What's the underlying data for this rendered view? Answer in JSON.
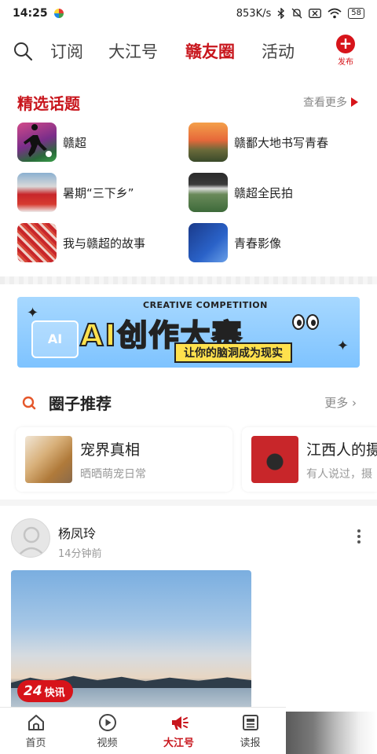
{
  "status_bar": {
    "time": "14:25",
    "network_speed": "853K/s",
    "battery": "58"
  },
  "top_nav": {
    "tabs": [
      {
        "label": "订阅",
        "active": false
      },
      {
        "label": "大江号",
        "active": false
      },
      {
        "label": "赣友圈",
        "active": true
      },
      {
        "label": "活动",
        "active": false
      }
    ],
    "publish_label": "发布",
    "accent_color": "#c8161d"
  },
  "featured_topics": {
    "title": "精选话题",
    "more_label": "查看更多",
    "items": [
      {
        "label": "赣超",
        "icon": "soccer-player-thumb"
      },
      {
        "label": "赣鄱大地书写青春",
        "icon": "sunset-landscape-thumb"
      },
      {
        "label": "暑期“三下乡”",
        "icon": "volunteers-group-thumb"
      },
      {
        "label": "赣超全民拍",
        "icon": "stadium-crowd-thumb"
      },
      {
        "label": "我与赣超的故事",
        "icon": "fans-crowd-thumb"
      },
      {
        "label": "青春影像",
        "icon": "youth-image-poster-thumb"
      }
    ]
  },
  "banner": {
    "competition_label": "CREATIVE COMPETITION",
    "title": "AI创作大赛",
    "subtitle": "让你的脑洞成为现实",
    "ai_box": "AI"
  },
  "circle_recommend": {
    "title": "圈子推荐",
    "more_label": "更多",
    "cards": [
      {
        "name": "宠界真相",
        "desc": "晒晒萌宠日常",
        "icon": "pets-thumb"
      },
      {
        "name": "江西人的摄",
        "desc": "有人说过，摄",
        "icon": "camera-thumb"
      }
    ]
  },
  "post": {
    "author": "杨凤玲",
    "time": "14分钟前"
  },
  "news_badge": {
    "number": "24",
    "text": "快讯"
  },
  "bottom_nav": {
    "items": [
      {
        "label": "首页",
        "icon": "home-icon",
        "active": false
      },
      {
        "label": "视频",
        "icon": "play-icon",
        "active": false
      },
      {
        "label": "大江号",
        "icon": "megaphone-icon",
        "active": true
      },
      {
        "label": "读报",
        "icon": "newspaper-icon",
        "active": false
      }
    ]
  }
}
